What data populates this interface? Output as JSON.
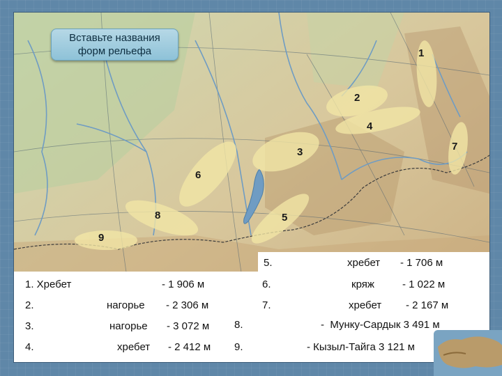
{
  "title_box": {
    "line1": "Вставьте названия",
    "line2": "форм рельефа"
  },
  "markers": [
    "1",
    "2",
    "3",
    "4",
    "5",
    "6",
    "7",
    "8",
    "9"
  ],
  "legend": {
    "row1": "1. Хребет",
    "row1_value": "- 1 906 м",
    "row2_num": "2.",
    "row2_word": "нагорье",
    "row2_value": "- 2 306 м",
    "row3_num": "3.",
    "row3_word": "нагорье",
    "row3_value": "- 3 072 м",
    "row4_num": "4.",
    "row4_word": "хребет",
    "row4_value": "- 2 412 м",
    "row5_num": "5.",
    "row5_word": "хребет",
    "row5_value": "- 1 706 м",
    "row6_num": "6.",
    "row6_word": "кряж",
    "row6_value": "- 1 022 м",
    "row7_num": "7.",
    "row7_word": "хребет",
    "row7_value": "- 2 167 м",
    "row8_num": "8.",
    "row8_value": "-  Мунку-Сардык 3 491 м",
    "row9_num": "9.",
    "row9_value": "- Кызыл-Тайга 3 121 м"
  },
  "colors": {
    "map_land": "#d9cfa9",
    "highlight": "#f3e7a6",
    "water": "#6f9cc3",
    "title_box": "#9fcde0"
  }
}
